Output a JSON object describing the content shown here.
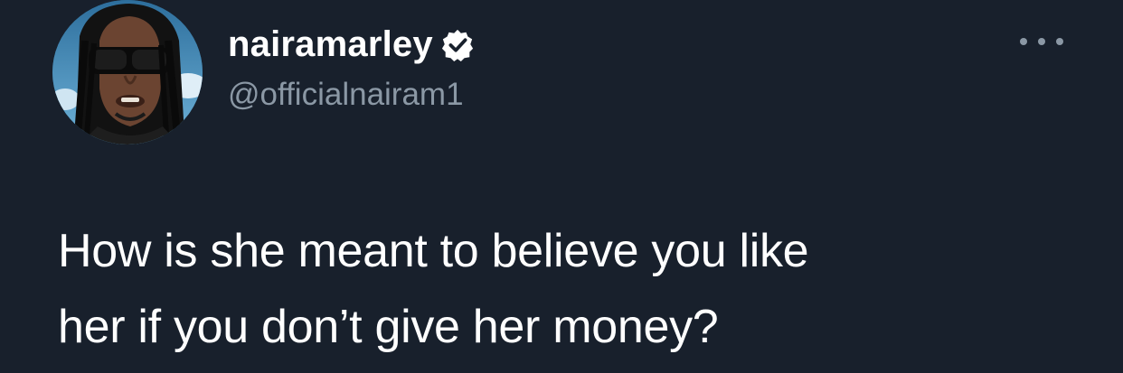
{
  "author": {
    "display_name": "nairamarley",
    "handle": "@officialnairam1",
    "verified": true,
    "avatar_icon": "profile-avatar"
  },
  "menu": {
    "icon": "more-options-icon"
  },
  "tweet": {
    "text_line_1": "How is she meant to believe you like",
    "text_line_2": "her if you don’t give her money?"
  },
  "colors": {
    "background": "#18202c",
    "text_primary": "#ffffff",
    "text_secondary": "#8b98a5",
    "verified_badge": "#ffffff"
  }
}
